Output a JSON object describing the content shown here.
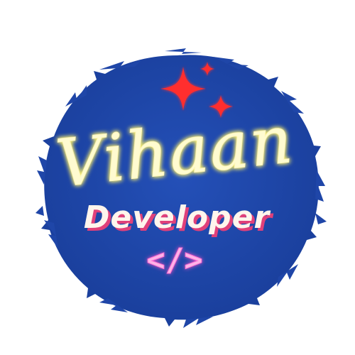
{
  "logo": {
    "name": "Vihaan",
    "role": "Developer",
    "code_symbol": "</>",
    "icon_names": [
      "sparkle-icon",
      "code-icon"
    ]
  },
  "colors": {
    "background": "#ffffff",
    "circle_blue": "#1f46a8",
    "circle_blue_dark": "#16388e",
    "sparkle_red": "#ff2e2e",
    "name_glow": "#fff36a",
    "name_fill": "#fffbd0",
    "role_fill": "#fff5ec",
    "role_shadow": "#e0407a",
    "code_pink": "#ff6fd3"
  }
}
